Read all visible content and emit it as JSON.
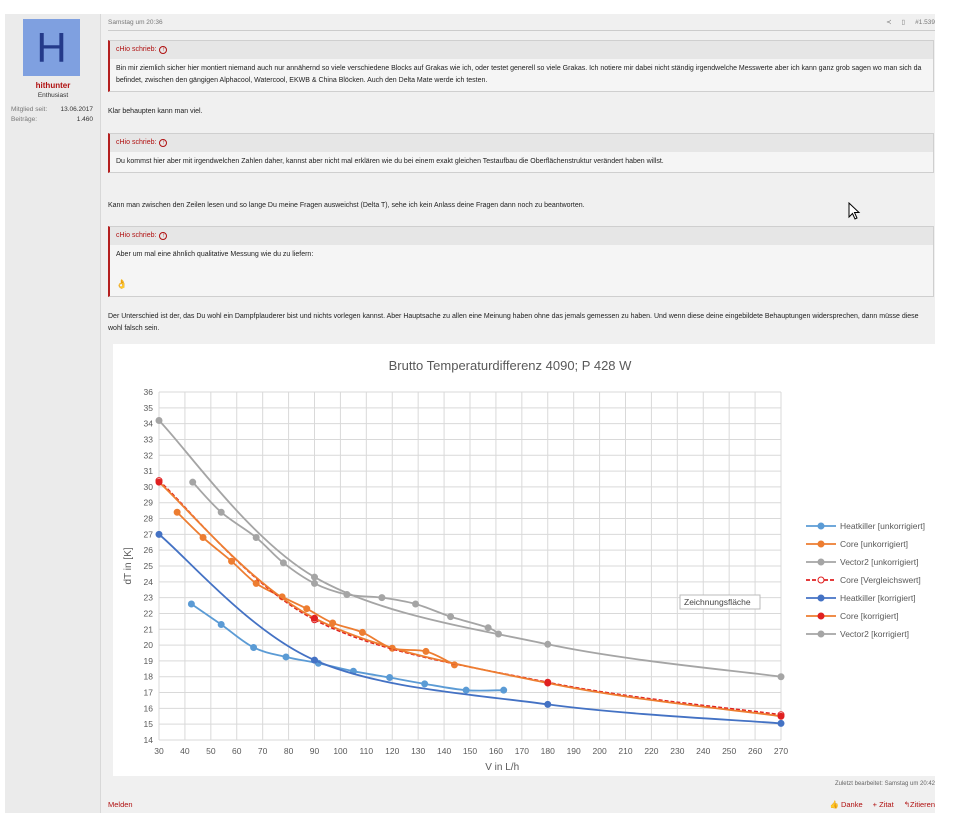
{
  "user": {
    "avatar_letter": "H",
    "name": "hithunter",
    "title": "Enthusiast",
    "member_since_label": "Mitglied seit:",
    "member_since": "13.06.2017",
    "posts_label": "Beiträge:",
    "posts": "1.460"
  },
  "post": {
    "date": "Samstag um 20:36",
    "number": "#1.539",
    "quotes": [
      {
        "author": "cHio schrieb:",
        "text": "Bin mir ziemlich sicher hier montiert niemand auch nur annähernd so viele verschiedene Blocks auf Grakas wie ich, oder testet generell so viele Grakas. Ich notiere mir dabei nicht ständig irgendwelche Messwerte aber ich kann ganz grob sagen wo man sich da befindet, zwischen den gängigen Alphacool, Watercool, EKWB & China Blöcken. Auch den Delta Mate werde ich testen."
      },
      {
        "author": "cHio schrieb:",
        "text": "Du kommst hier aber mit irgendwelchen Zahlen daher, kannst aber nicht mal erklären wie du bei einem exakt gleichen Testaufbau die Oberflächenstruktur verändert haben willst."
      },
      {
        "author": "cHio schrieb:",
        "text": "Aber um mal eine ähnlich qualitative Messung wie du zu liefern:",
        "emoji": "👌"
      }
    ],
    "replies": [
      "Klar behaupten kann man viel.",
      "Kann man zwischen den Zeilen lesen und so lange Du meine Fragen ausweichst (Delta T), sehe ich kein Anlass deine Fragen dann noch zu beantworten.",
      "Der Unterschied ist der, das Du wohl ein Dampfplauderer bist und nichts vorlegen kannst. Aber Hauptsache zu allen eine Meinung haben ohne das jemals gemessen zu haben. Und wenn diese deine eingebildete Behauptungen widersprechen, dann müsse diese wohl falsch sein."
    ],
    "last_edited": "Zuletzt bearbeitet: Samstag um 20:42",
    "report": "Melden",
    "like": "Danke",
    "add_quote": "+ Zitat",
    "quote": "Zitieren"
  },
  "chart_data": {
    "type": "line",
    "title": "Brutto Temperaturdifferenz 4090; P 428 W",
    "xlabel": "V in L/h",
    "ylabel": "dT in [K]",
    "xlim": [
      30,
      270
    ],
    "ylim": [
      14,
      36
    ],
    "xstep": 10,
    "ystep": 1,
    "grid": true,
    "legend": "right",
    "tooltip": "Zeichnungsfläche",
    "series": [
      {
        "name": "Heatkiller [unkorrigiert]",
        "color": "#5b9bd5",
        "points": [
          [
            42.5,
            22.6
          ],
          [
            54,
            21.3
          ],
          [
            66.5,
            19.85
          ],
          [
            79,
            19.25
          ],
          [
            91.5,
            18.85
          ],
          [
            105,
            18.35
          ],
          [
            119,
            17.95
          ],
          [
            132.5,
            17.55
          ],
          [
            148.5,
            17.15
          ],
          [
            163,
            17.15
          ]
        ]
      },
      {
        "name": "Core [unkorrigiert]",
        "color": "#ed7d31",
        "points": [
          [
            37,
            28.4
          ],
          [
            47,
            26.8
          ],
          [
            58,
            25.3
          ],
          [
            67.5,
            23.9
          ],
          [
            77.5,
            23.05
          ],
          [
            87,
            22.3
          ],
          [
            97,
            21.4
          ],
          [
            108.5,
            20.8
          ],
          [
            120,
            19.8
          ],
          [
            133,
            19.6
          ],
          [
            144,
            18.75
          ]
        ]
      },
      {
        "name": "Vector2 [unkorrigiert]",
        "color": "#a5a5a5",
        "points": [
          [
            43,
            30.3
          ],
          [
            54,
            28.4
          ],
          [
            67.5,
            26.8
          ],
          [
            78,
            25.2
          ],
          [
            90,
            23.9
          ],
          [
            102.5,
            23.2
          ],
          [
            116,
            23.0
          ],
          [
            129,
            22.6
          ],
          [
            142.5,
            21.8
          ],
          [
            157,
            21.1
          ],
          [
            161,
            20.7
          ]
        ]
      },
      {
        "name": "Core [Vergleichswert]",
        "color": "#e02020",
        "dashed": true,
        "open": true,
        "points": [
          [
            30,
            30.4
          ],
          [
            90,
            21.6
          ],
          [
            180,
            17.65
          ],
          [
            270,
            15.6
          ]
        ]
      },
      {
        "name": "Heatkiller [korrigiert]",
        "color": "#4472c4",
        "points": [
          [
            30,
            27.0
          ],
          [
            90,
            19.05
          ],
          [
            180,
            16.25
          ],
          [
            270,
            15.05
          ]
        ]
      },
      {
        "name": "Core [korrigiert]",
        "color": "#ed7d31",
        "marker": "#e02020",
        "points": [
          [
            30,
            30.3
          ],
          [
            90,
            21.7
          ],
          [
            180,
            17.6
          ],
          [
            270,
            15.5
          ]
        ]
      },
      {
        "name": "Vector2 [korrigiert]",
        "color": "#a5a5a5",
        "points": [
          [
            30,
            34.2
          ],
          [
            90,
            24.3
          ],
          [
            180,
            20.05
          ],
          [
            270,
            18.0
          ]
        ]
      }
    ]
  }
}
